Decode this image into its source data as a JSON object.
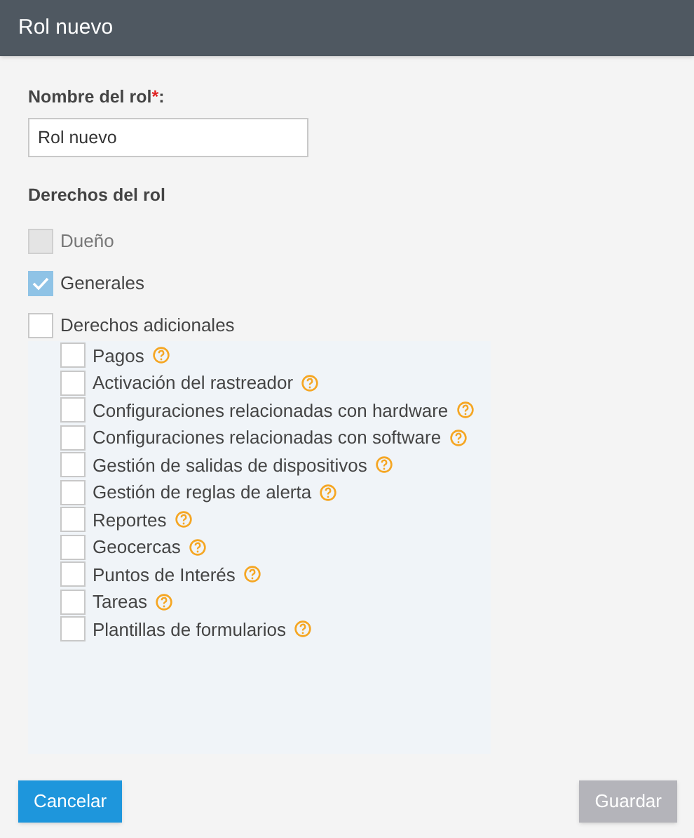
{
  "window": {
    "title": "Rol nuevo"
  },
  "name_field": {
    "label": "Nombre del rol",
    "required_mark": "*",
    "suffix": ":",
    "value": "Rol nuevo"
  },
  "rights": {
    "heading": "Derechos del rol",
    "items": [
      {
        "label": "Dueño",
        "checked": false,
        "disabled": true
      },
      {
        "label": "Generales",
        "checked": true,
        "disabled": false
      },
      {
        "label": "Derechos adicionales",
        "checked": false,
        "disabled": false,
        "children": [
          {
            "label": "Pagos",
            "checked": false,
            "help": true
          },
          {
            "label": "Activación del rastreador",
            "checked": false,
            "help": true
          },
          {
            "label": "Configuraciones relacionadas con hardware",
            "checked": false,
            "help": true
          },
          {
            "label": "Configuraciones relacionadas con software",
            "checked": false,
            "help": true
          },
          {
            "label": "Gestión de salidas de dispositivos",
            "checked": false,
            "help": true
          },
          {
            "label": "Gestión de reglas de alerta",
            "checked": false,
            "help": true
          },
          {
            "label": "Reportes",
            "checked": false,
            "help": true
          },
          {
            "label": "Geocercas",
            "checked": false,
            "help": true
          },
          {
            "label": "Puntos de Interés",
            "checked": false,
            "help": true
          },
          {
            "label": "Tareas",
            "checked": false,
            "help": true
          },
          {
            "label": "Plantillas de formularios",
            "checked": false,
            "help": true
          }
        ]
      }
    ]
  },
  "buttons": [
    {
      "label": "Cancelar",
      "disabled": false
    },
    {
      "label": "Guardar",
      "disabled": true
    }
  ]
}
